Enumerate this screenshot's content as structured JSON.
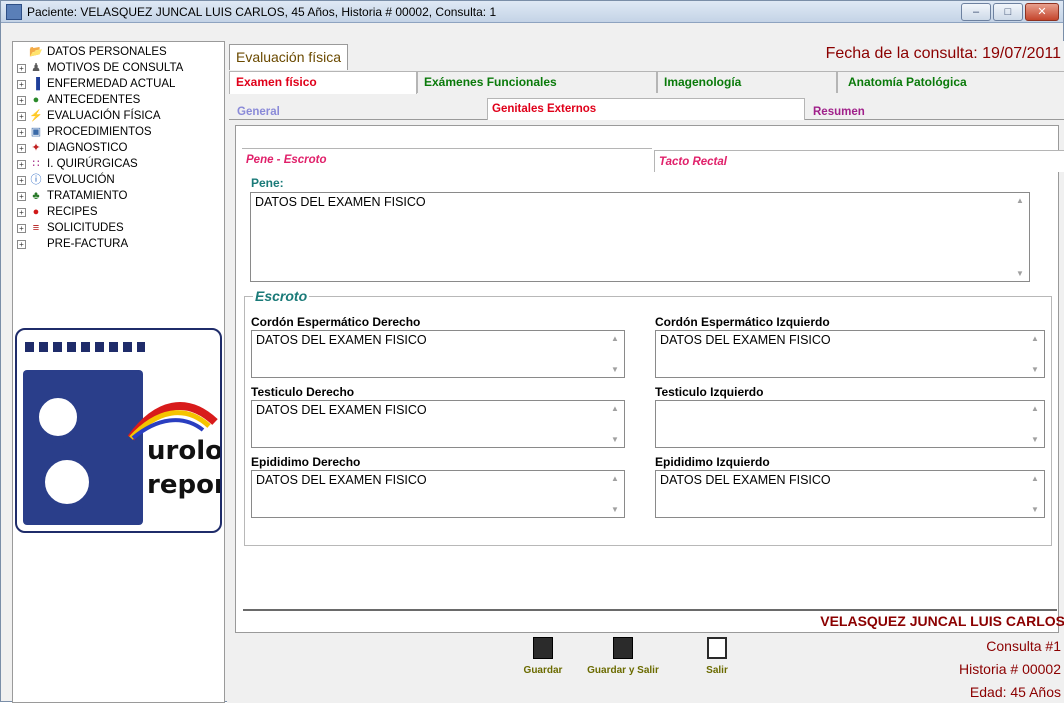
{
  "window": {
    "title": "Paciente: VELASQUEZ JUNCAL LUIS CARLOS, 45 Años, Historia # 00002, Consulta: 1",
    "min_label": "–",
    "max_label": "□",
    "close_label": "✕"
  },
  "sidebar": {
    "items": [
      {
        "label": "DATOS PERSONALES",
        "icon": "folder-icon",
        "glyph": "📂",
        "expandable": false
      },
      {
        "label": "MOTIVOS DE CONSULTA",
        "icon": "person-icon",
        "glyph": "♟",
        "expandable": true
      },
      {
        "label": "ENFERMEDAD ACTUAL",
        "icon": "bar-chart-icon",
        "glyph": "▐",
        "expandable": true
      },
      {
        "label": "ANTECEDENTES",
        "icon": "money-bag-icon",
        "glyph": "●",
        "expandable": true
      },
      {
        "label": "EVALUACIÓN FÍSICA",
        "icon": "lightning-icon",
        "glyph": "⚡",
        "expandable": true
      },
      {
        "label": "PROCEDIMIENTOS",
        "icon": "picture-icon",
        "glyph": "▣",
        "expandable": true
      },
      {
        "label": "DIAGNOSTICO",
        "icon": "stethoscope-icon",
        "glyph": "✦",
        "expandable": true
      },
      {
        "label": "I. QUIRÚRGICAS",
        "icon": "grid-icon",
        "glyph": "∷",
        "expandable": true
      },
      {
        "label": "EVOLUCIÓN",
        "icon": "info-icon",
        "glyph": "ⓘ",
        "expandable": true
      },
      {
        "label": "TRATAMIENTO",
        "icon": "plant-icon",
        "glyph": "♣",
        "expandable": true
      },
      {
        "label": "RECIPES",
        "icon": "apple-icon",
        "glyph": "●",
        "expandable": true
      },
      {
        "label": "SOLICITUDES",
        "icon": "list-icon",
        "glyph": "≡",
        "expandable": true
      },
      {
        "label": "PRE-FACTURA",
        "icon": "blank-icon",
        "glyph": "",
        "expandable": true
      }
    ],
    "logo": {
      "line1": "urolo",
      "line2": "report"
    }
  },
  "main": {
    "top_tab": "Evaluación física",
    "fecha": "Fecha de la consulta:  19/07/2011",
    "tabs": [
      {
        "label": "Examen físico",
        "color": "#e0001a"
      },
      {
        "label": "Exámenes Funcionales",
        "color": "#0a7a0a"
      },
      {
        "label": "Imagenología",
        "color": "#0a7a0a"
      },
      {
        "label": "Anatomía Patológica",
        "color": "#0a7a0a"
      }
    ],
    "subtabs": [
      {
        "label": "General",
        "color": "#8a8ad8"
      },
      {
        "label": "Genitales Externos",
        "color": "#e0001a"
      },
      {
        "label": "Resumen",
        "color": "#a0208a"
      }
    ],
    "section_tabs": [
      {
        "label": "Pene - Escroto"
      },
      {
        "label": "Tacto Rectal"
      }
    ],
    "pene": {
      "label": "Pene:",
      "value": "DATOS DEL EXAMEN FISICO"
    },
    "escroto": {
      "title": "Escroto",
      "fields": [
        {
          "label": "Cordón Espermático Derecho",
          "value": "DATOS DEL EXAMEN FISICO"
        },
        {
          "label": "Cordón Espermático Izquierdo",
          "value": "DATOS DEL EXAMEN FISICO"
        },
        {
          "label": "Testiculo Derecho",
          "value": "DATOS DEL EXAMEN FISICO"
        },
        {
          "label": "Testiculo Izquierdo",
          "value": ""
        },
        {
          "label": "Epididimo Derecho",
          "value": "DATOS DEL EXAMEN FISICO"
        },
        {
          "label": "Epididimo Izquierdo",
          "value": "DATOS DEL EXAMEN FISICO"
        }
      ]
    },
    "patient": {
      "name": "VELASQUEZ JUNCAL LUIS CARLOS",
      "consulta": "Consulta #1",
      "historia": "Historia # 00002",
      "edad": "Edad: 45 Años"
    },
    "buttons": [
      {
        "label": "Guardar",
        "icon": "floppy-disk-icon"
      },
      {
        "label": "Guardar y Salir",
        "icon": "save-exit-icon"
      },
      {
        "label": "Salir",
        "icon": "exit-door-icon"
      }
    ]
  }
}
